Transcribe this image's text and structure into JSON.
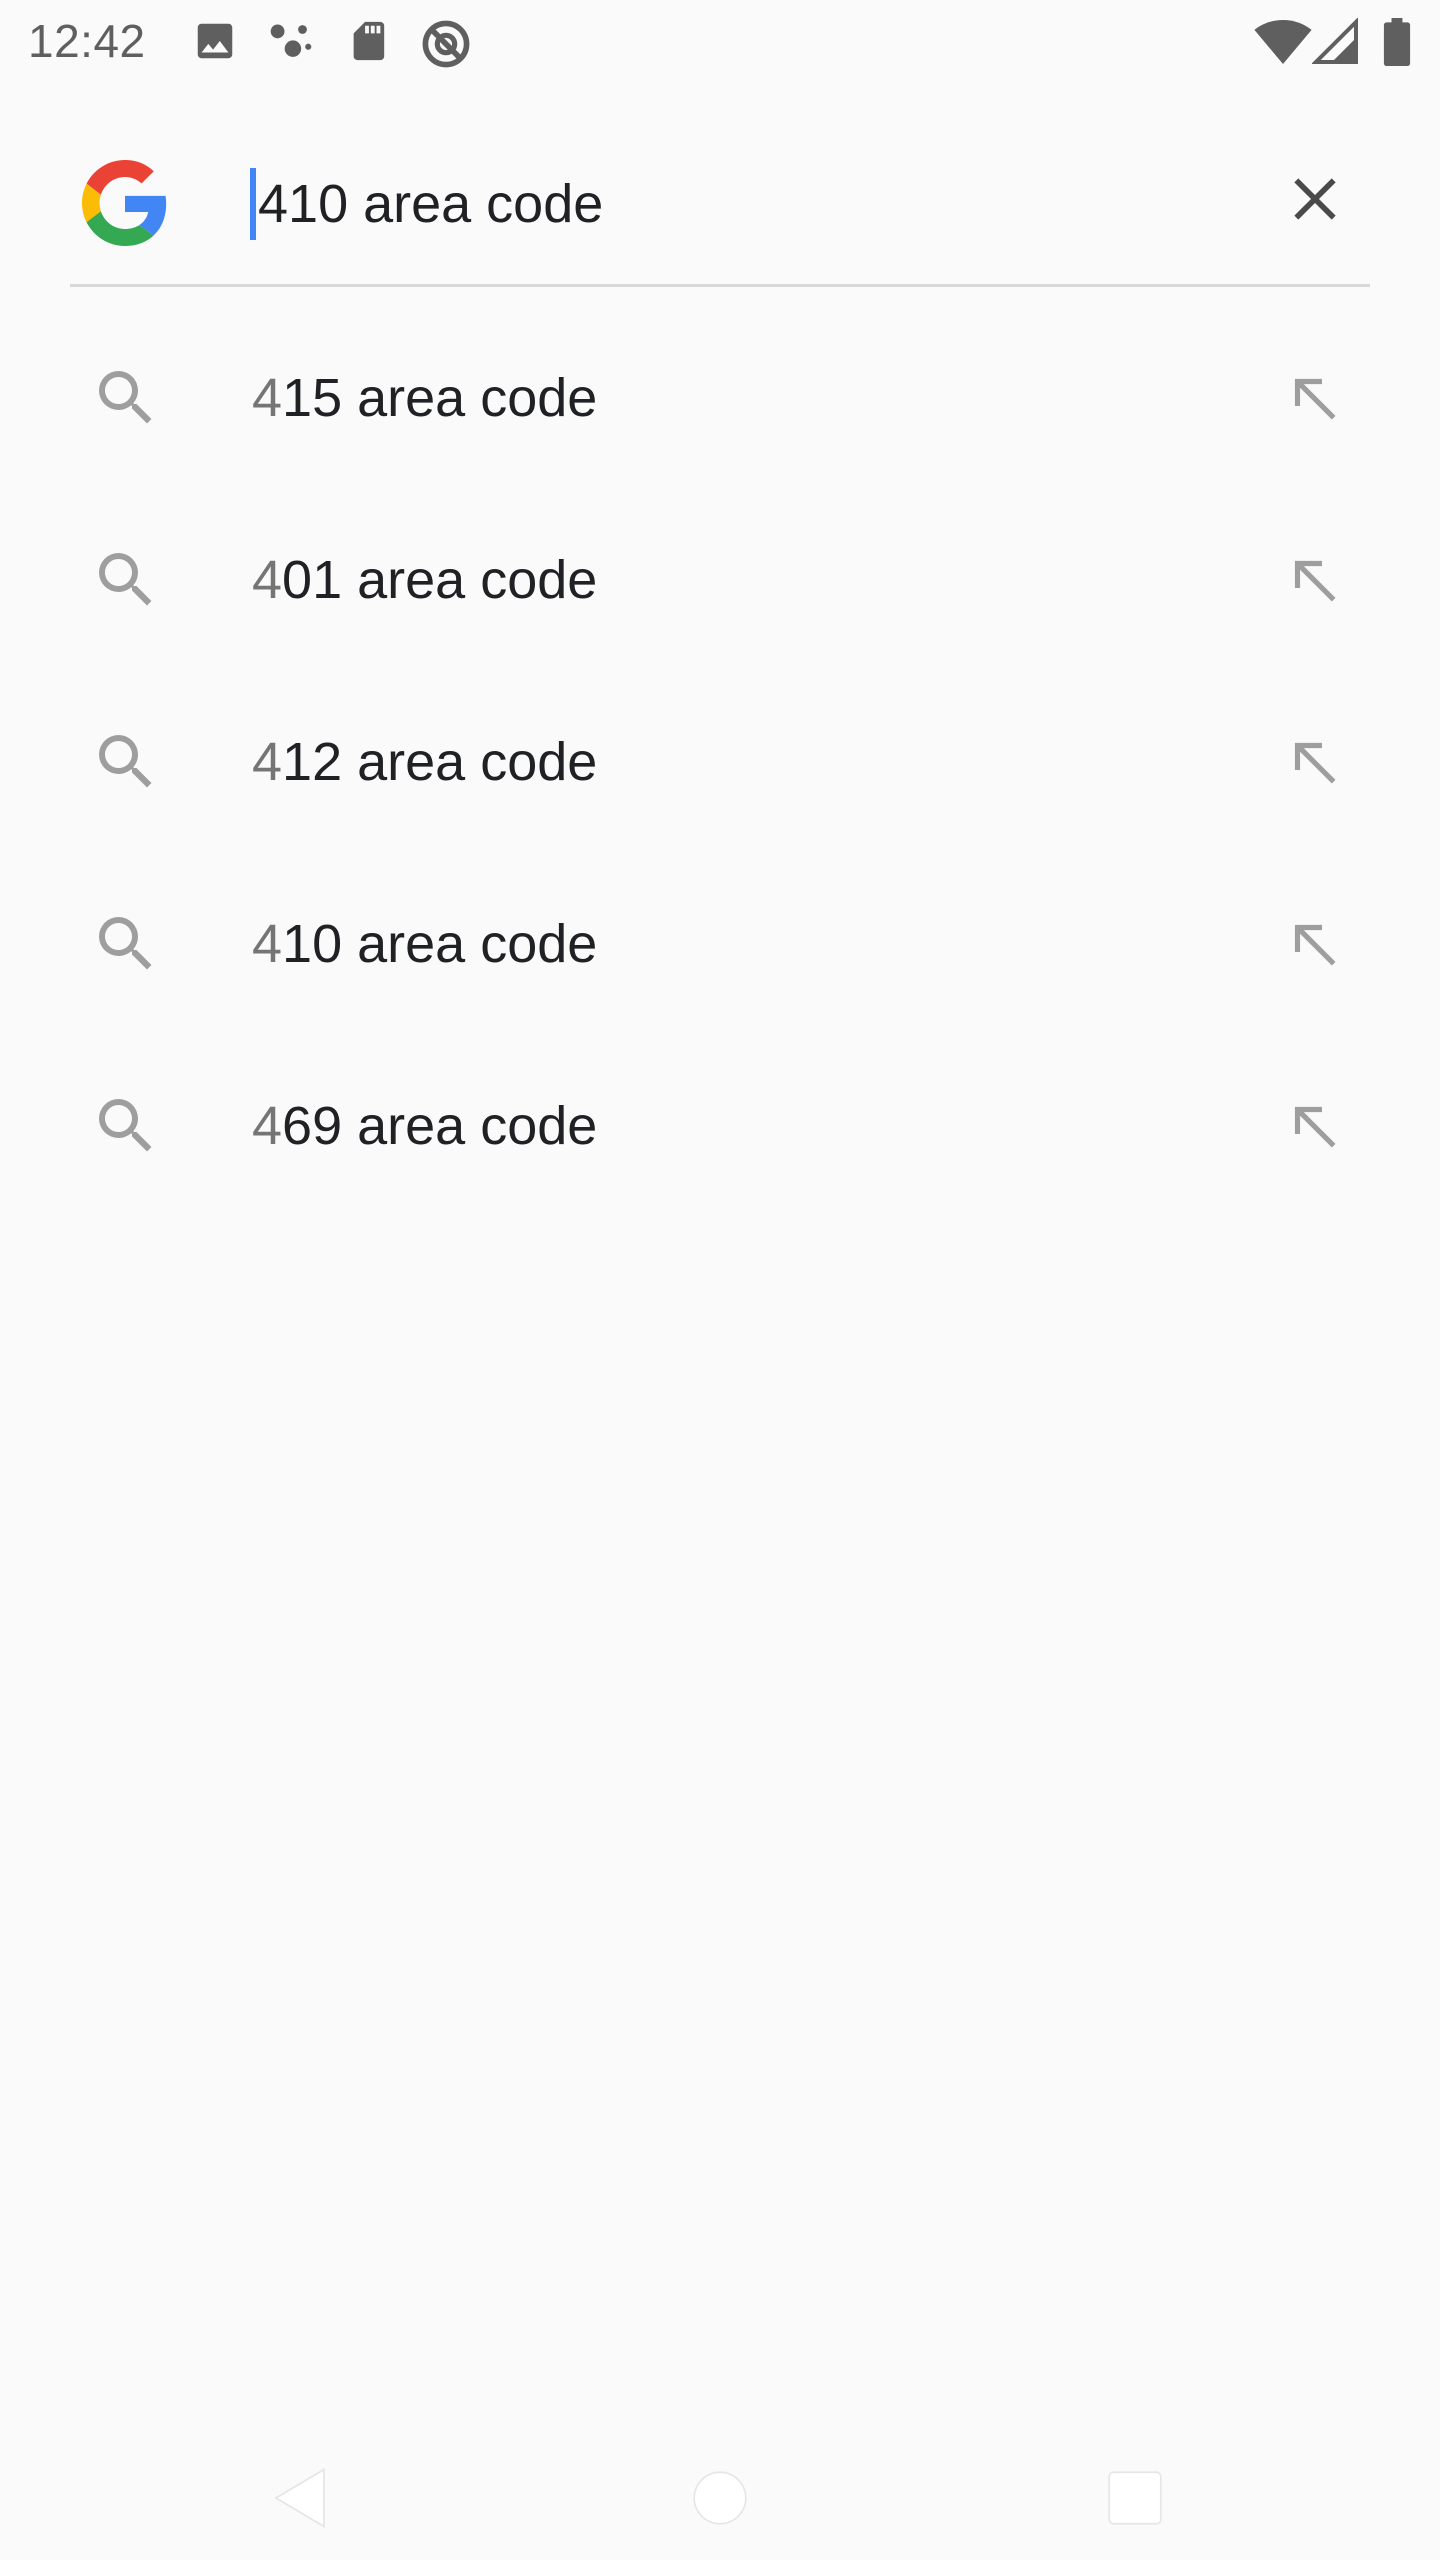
{
  "status_bar": {
    "time": "12:42",
    "left_icons": [
      "image-icon",
      "assistant-dots-icon",
      "sd-card-icon",
      "data-saver-icon"
    ],
    "right_icons": [
      "wifi-icon",
      "cell-signal-icon",
      "battery-icon"
    ]
  },
  "search": {
    "query": "410 area code",
    "logo": "google-g-icon",
    "clear_icon": "close-icon"
  },
  "suggestions": [
    {
      "typed": "4",
      "rest": "15 area code"
    },
    {
      "typed": "4",
      "rest": "01 area code"
    },
    {
      "typed": "4",
      "rest": "12 area code"
    },
    {
      "typed": "4",
      "rest": "10 area code"
    },
    {
      "typed": "4",
      "rest": "69 area code"
    }
  ],
  "nav_bar": {
    "buttons": [
      "back-icon",
      "home-icon",
      "recents-icon"
    ]
  },
  "colors": {
    "background": "#fafafa",
    "caret": "#4285f4",
    "text_primary": "#202124",
    "text_secondary": "#757575",
    "icon_gray": "#9e9e9e",
    "divider": "#d8d8d8"
  }
}
